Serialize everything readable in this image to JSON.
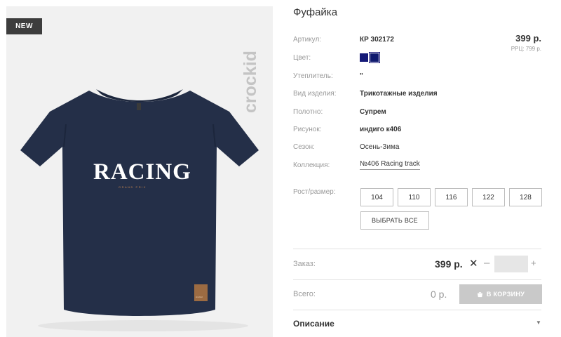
{
  "image": {
    "badge": "NEW",
    "brand": "crockid",
    "print_main": "RACING",
    "print_sub": "GRAND PRIX",
    "tag": "crockid"
  },
  "product": {
    "title": "Фуфайка",
    "price": "399 р.",
    "rrc": "РРЦ: 799 р.",
    "props": [
      {
        "label": "Артикул:",
        "value": "КР 302172"
      },
      {
        "label": "Цвет:",
        "value": ""
      },
      {
        "label": "Утеплитель:",
        "value": "\""
      },
      {
        "label": "Вид изделия:",
        "value": "Трикотажные изделия"
      },
      {
        "label": "Полотно:",
        "value": "Супрем"
      },
      {
        "label": "Рисунок:",
        "value": "индиго к406"
      },
      {
        "label": "Сезон:",
        "value": "Осень-Зима"
      },
      {
        "label": "Коллекция:",
        "value": "№406 Racing track"
      }
    ],
    "colors": [
      "#151a78",
      "#0f1a6e"
    ],
    "size_label": "Рост/размер:",
    "sizes": [
      "104",
      "110",
      "116",
      "122",
      "128"
    ],
    "select_all": "ВЫБРАТЬ ВСЕ"
  },
  "order": {
    "label": "Заказ:",
    "price": "399 р.",
    "times": "✕",
    "minus": "–",
    "plus": "+",
    "quantity": ""
  },
  "total": {
    "label": "Всего:",
    "value": "0 р.",
    "cart_label": "В КОРЗИНУ"
  },
  "description": {
    "label": "Описание",
    "chevron": "▼"
  }
}
